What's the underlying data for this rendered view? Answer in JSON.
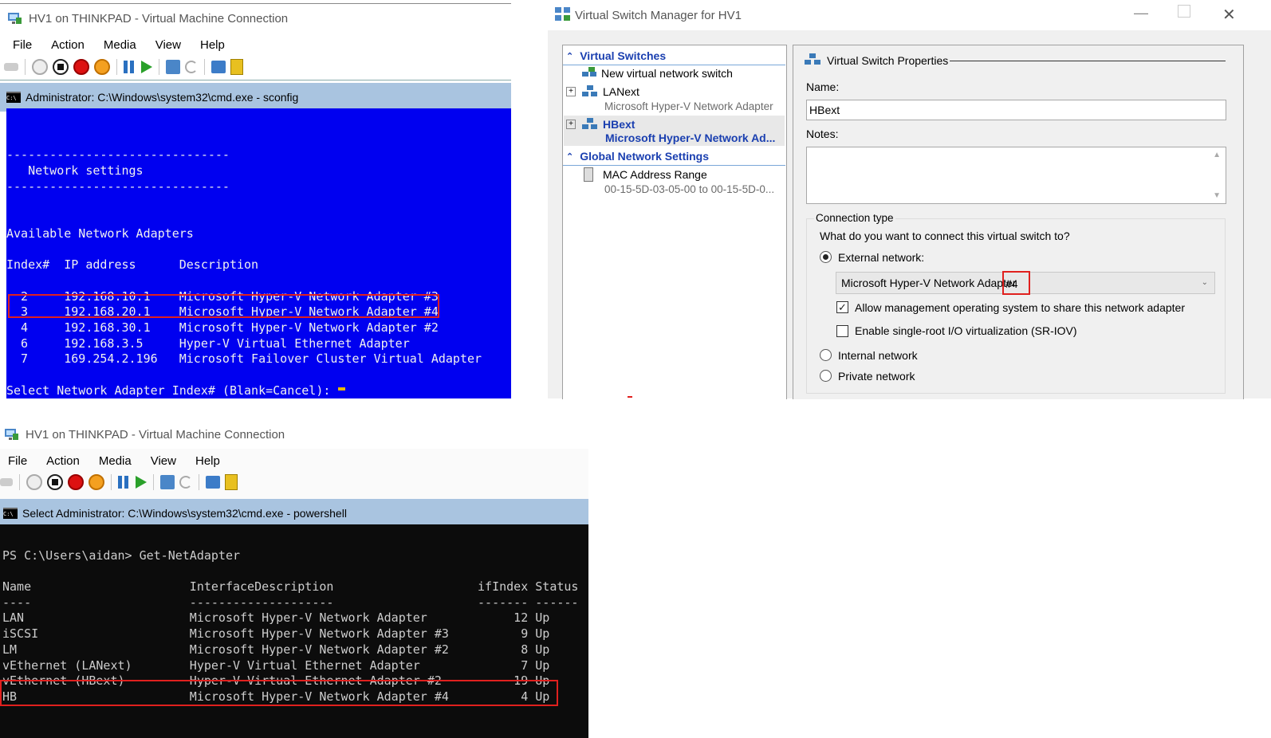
{
  "vm_top": {
    "title": "HV1 on THINKPAD - Virtual Machine Connection",
    "menu": [
      "File",
      "Action",
      "Media",
      "View",
      "Help"
    ],
    "cmd_title": "Administrator: C:\\Windows\\system32\\cmd.exe - sconfig",
    "console_lines": [
      "",
      "",
      "-------------------------------",
      "   Network settings",
      "-------------------------------",
      "",
      "",
      "Available Network Adapters",
      "",
      "Index#  IP address      Description",
      "",
      "  2     192.168.10.1    Microsoft Hyper-V Network Adapter #3",
      "  3     192.168.20.1    Microsoft Hyper-V Network Adapter #4",
      "  4     192.168.30.1    Microsoft Hyper-V Network Adapter #2",
      "  6     192.168.3.5     Hyper-V Virtual Ethernet Adapter",
      "  7     169.254.2.196   Microsoft Failover Cluster Virtual Adapter",
      "",
      "Select Network Adapter Index# (Blank=Cancel): "
    ]
  },
  "vm_bottom": {
    "title": "HV1 on THINKPAD - Virtual Machine Connection",
    "menu": [
      "File",
      "Action",
      "Media",
      "View",
      "Help"
    ],
    "cmd_title": "Select Administrator: C:\\Windows\\system32\\cmd.exe - powershell",
    "console_lines": [
      "",
      "PS C:\\Users\\aidan> Get-NetAdapter",
      "",
      "Name                      InterfaceDescription                    ifIndex Status",
      "----                      --------------------                    ------- ------",
      "LAN                       Microsoft Hyper-V Network Adapter            12 Up",
      "iSCSI                     Microsoft Hyper-V Network Adapter #3          9 Up",
      "LM                        Microsoft Hyper-V Network Adapter #2          8 Up",
      "vEthernet (LANext)        Hyper-V Virtual Ethernet Adapter              7 Up",
      "vEthernet (HBext)         Hyper-V Virtual Ethernet Adapter #2          19 Up",
      "HB                        Microsoft Hyper-V Network Adapter #4          4 Up"
    ]
  },
  "vsm": {
    "title": "Virtual Switch Manager for HV1",
    "section_switches": "Virtual Switches",
    "new_switch": "New virtual network switch",
    "switches": [
      {
        "name": "LANext",
        "adapter": "Microsoft Hyper-V Network Adapter"
      },
      {
        "name": "HBext",
        "adapter": "Microsoft Hyper-V Network Ad..."
      }
    ],
    "section_global": "Global Network Settings",
    "mac_label": "MAC Address Range",
    "mac_value": "00-15-5D-03-05-00 to 00-15-5D-0...",
    "props_title": "Virtual Switch Properties",
    "name_label": "Name:",
    "name_value": "HBext",
    "notes_label": "Notes:",
    "conn_type": "Connection type",
    "conn_question": "What do you want to connect this virtual switch to?",
    "external": "External network:",
    "adapter_select": "Microsoft Hyper-V Network Adapter",
    "adapter_suffix": "#4",
    "allow_mgmt": "Allow management operating system to share this network adapter",
    "sriov": "Enable single-root I/O virtualization (SR-IOV)",
    "internal": "Internal network",
    "private": "Private network"
  },
  "colors": {
    "console_blue": "#0000f0",
    "console_black": "#0c0c0c",
    "highlight_red": "#e0201e",
    "tree_blue": "#1a3fb0"
  }
}
